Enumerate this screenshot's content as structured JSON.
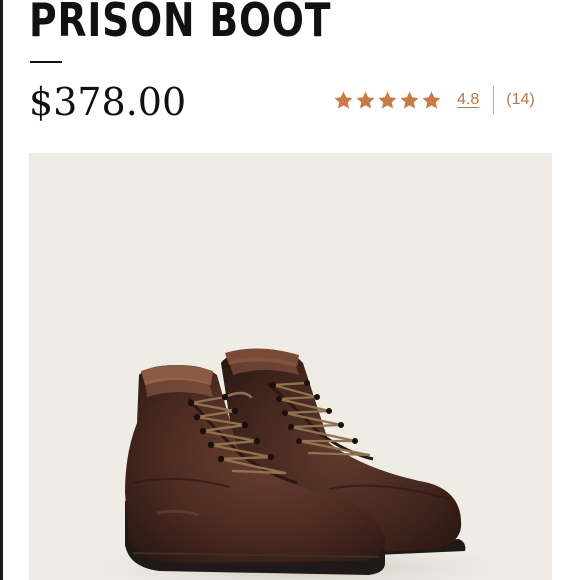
{
  "product": {
    "title": "PRISON BOOT",
    "price": "$378.00"
  },
  "rating": {
    "stars": 5,
    "score": "4.8",
    "count": "(14)",
    "star_color": "#c97a47",
    "icon": "star-icon"
  },
  "colors": {
    "image_background": "#efebe5",
    "boot_leather": "#4a2a20",
    "sole": "#1f1a17",
    "accent_text": "#b07a4e"
  }
}
